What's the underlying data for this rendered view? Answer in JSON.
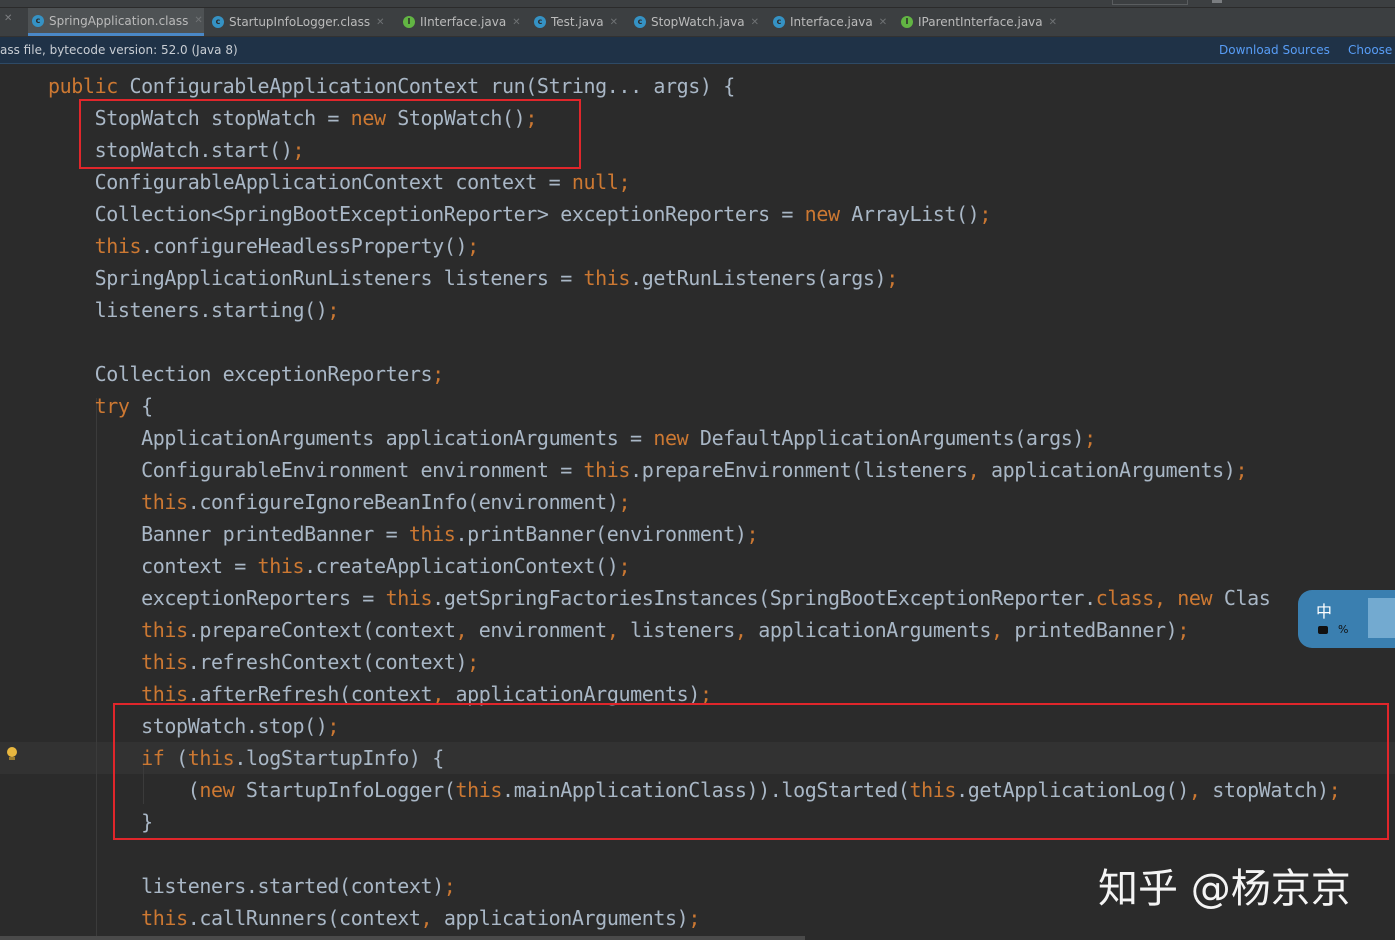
{
  "tabs": [
    {
      "label": "SpringApplication.class",
      "icon": "class-file-icon",
      "active": true
    },
    {
      "label": "StartupInfoLogger.class",
      "icon": "class-file-icon",
      "active": false
    },
    {
      "label": "IInterface.java",
      "icon": "interface-file-icon",
      "active": false
    },
    {
      "label": "Test.java",
      "icon": "class-file-icon",
      "active": false
    },
    {
      "label": "StopWatch.java",
      "icon": "class-file-icon",
      "active": false
    },
    {
      "label": "Interface.java",
      "icon": "class-file-icon",
      "active": false
    },
    {
      "label": "IParentInterface.java",
      "icon": "interface-file-icon",
      "active": false
    }
  ],
  "banner": {
    "message": "ass file, bytecode version: 52.0 (Java 8)",
    "download_sources": "Download Sources",
    "choose": "Choose"
  },
  "code": {
    "lines": [
      "public ConfigurableApplicationContext run(String... args) {",
      "    StopWatch stopWatch = new StopWatch();",
      "    stopWatch.start();",
      "    ConfigurableApplicationContext context = null;",
      "    Collection<SpringBootExceptionReporter> exceptionReporters = new ArrayList();",
      "    this.configureHeadlessProperty();",
      "    SpringApplicationRunListeners listeners = this.getRunListeners(args);",
      "    listeners.starting();",
      "",
      "    Collection exceptionReporters;",
      "    try {",
      "        ApplicationArguments applicationArguments = new DefaultApplicationArguments(args);",
      "        ConfigurableEnvironment environment = this.prepareEnvironment(listeners, applicationArguments);",
      "        this.configureIgnoreBeanInfo(environment);",
      "        Banner printedBanner = this.printBanner(environment);",
      "        context = this.createApplicationContext();",
      "        exceptionReporters = this.getSpringFactoriesInstances(SpringBootExceptionReporter.class, new Clas",
      "        this.prepareContext(context, environment, listeners, applicationArguments, printedBanner);",
      "        this.refreshContext(context);",
      "        this.afterRefresh(context, applicationArguments);",
      "        stopWatch.stop();",
      "        if (this.logStartupInfo) {",
      "            (new StartupInfoLogger(this.mainApplicationClass)).logStarted(this.getApplicationLog(), stopWatch);",
      "        }",
      "",
      "        listeners.started(context);",
      "        this.callRunners(context, applicationArguments);"
    ]
  },
  "colors": {
    "editor_bg": "#2b2b2b",
    "keyword": "#cc7832",
    "identifier": "#a9b7c6",
    "highlight_box": "#e0262b",
    "link": "#589df6"
  },
  "ime": {
    "label": "中",
    "extra": "%"
  },
  "watermark": "知乎 @杨京京"
}
